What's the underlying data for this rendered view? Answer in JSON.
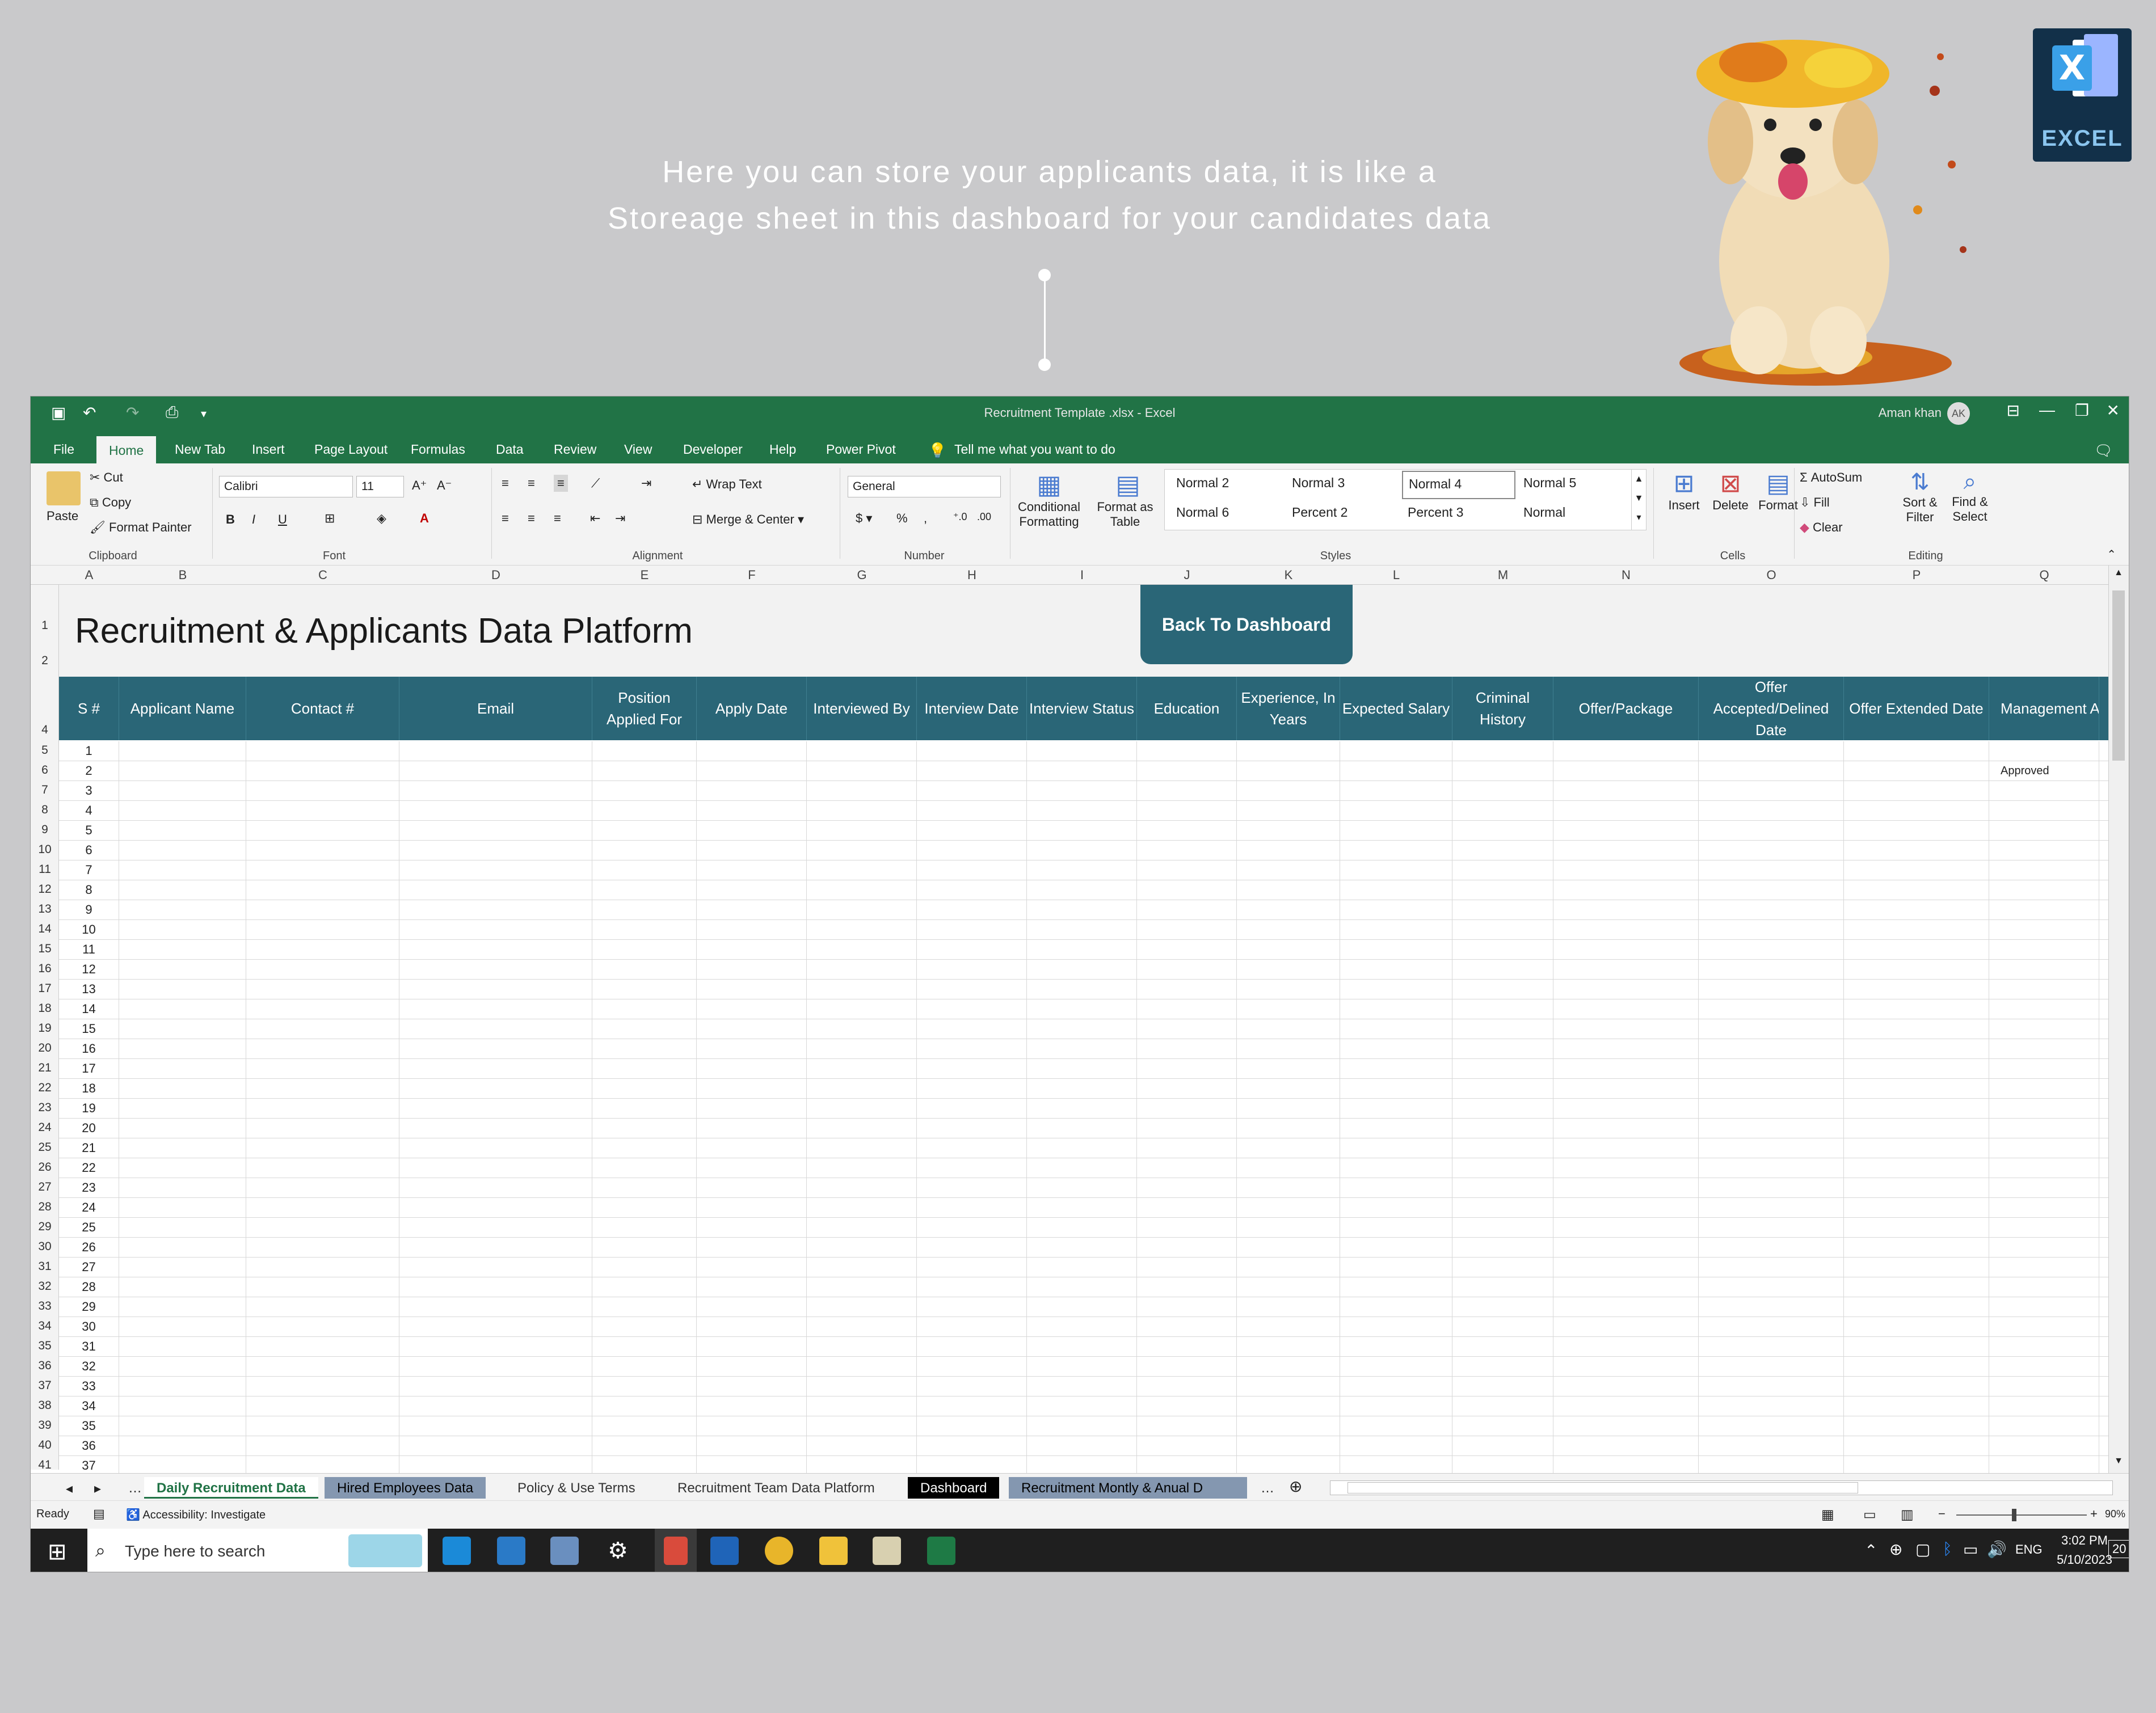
{
  "caption": {
    "line1": "Here you can store your applicants data, it is like a",
    "line2": "Storeage sheet in this dashboard for your candidates data"
  },
  "logo": {
    "label": "EXCEL"
  },
  "window": {
    "title": "Recruitment Template .xlsx  -  Excel",
    "user": "Aman khan",
    "user_initials": "AK"
  },
  "ribbon_tabs": [
    "File",
    "Home",
    "New Tab",
    "Insert",
    "Page Layout",
    "Formulas",
    "Data",
    "Review",
    "View",
    "Developer",
    "Help",
    "Power Pivot"
  ],
  "tell_me": "Tell me what you want to do",
  "ribbon": {
    "paste": "Paste",
    "cut": "Cut",
    "copy": "Copy",
    "format_painter": "Format Painter",
    "font_name": "Calibri",
    "font_size": "11",
    "wrap_text": "Wrap Text",
    "merge_center": "Merge & Center",
    "number_format": "General",
    "conditional_formatting": "Conditional Formatting",
    "format_as_table": "Format as Table",
    "styles": [
      "Normal 2",
      "Normal 3",
      "Normal 4",
      "Normal 5",
      "Normal 6",
      "Percent 2",
      "Percent 3",
      "Normal"
    ],
    "insert": "Insert",
    "delete": "Delete",
    "format": "Format",
    "autosum": "AutoSum",
    "fill": "Fill",
    "clear": "Clear",
    "sort_filter": "Sort & Filter",
    "find_select": "Find & Select",
    "groups": {
      "clipboard": "Clipboard",
      "font": "Font",
      "alignment": "Alignment",
      "number": "Number",
      "styles": "Styles",
      "cells": "Cells",
      "editing": "Editing"
    }
  },
  "columns": [
    "A",
    "B",
    "C",
    "D",
    "E",
    "F",
    "G",
    "H",
    "I",
    "J",
    "K",
    "L",
    "M",
    "N",
    "O",
    "P",
    "Q"
  ],
  "sheet": {
    "title": "Recruitment & Applicants Data Platform",
    "back_button": "Back To Dashboard",
    "headers": [
      "S #",
      "Applicant Name",
      "Contact #",
      "Email",
      "Position Applied For",
      "Apply Date",
      "Interviewed By",
      "Interview Date",
      "Interview Status",
      "Education",
      "Experience, In Years",
      "Expected Salary",
      "Criminal History",
      "Offer/Package",
      "Offer Accepted/Delined Date",
      "Offer Extended Date",
      "Management Approval Status"
    ],
    "row_numbers": [
      "5",
      "6",
      "7",
      "8",
      "9",
      "10",
      "11",
      "12",
      "13",
      "14",
      "15",
      "16",
      "17",
      "18",
      "19",
      "20",
      "21",
      "22",
      "23",
      "24",
      "25",
      "26",
      "27",
      "28",
      "29",
      "30",
      "31",
      "32",
      "33",
      "34",
      "35",
      "36",
      "37",
      "38",
      "39",
      "40",
      "41"
    ],
    "serials": [
      "1",
      "2",
      "3",
      "4",
      "5",
      "6",
      "7",
      "8",
      "9",
      "10",
      "11",
      "12",
      "13",
      "14",
      "15",
      "16",
      "17",
      "18",
      "19",
      "20",
      "21",
      "22",
      "23",
      "24",
      "25",
      "26",
      "27",
      "28",
      "29",
      "30",
      "31",
      "32",
      "33",
      "34",
      "35",
      "36",
      "37"
    ],
    "approved_text": "Approved"
  },
  "sheet_tabs": [
    "Daily Recruitment Data",
    "Hired Employees Data",
    "Policy & Use Terms",
    "Recruitment Team Data Platform",
    "Dashboard",
    "Recruitment Montly & Anual D"
  ],
  "status": {
    "ready": "Ready",
    "accessibility": "Accessibility: Investigate",
    "zoom": "90%"
  },
  "taskbar": {
    "search_placeholder": "Type here to search",
    "time": "3:02 PM",
    "date": "5/10/2023",
    "lang": "ENG",
    "notifications": "20"
  },
  "colors": {
    "excel_green": "#217346",
    "header_teal": "#2a6677"
  }
}
